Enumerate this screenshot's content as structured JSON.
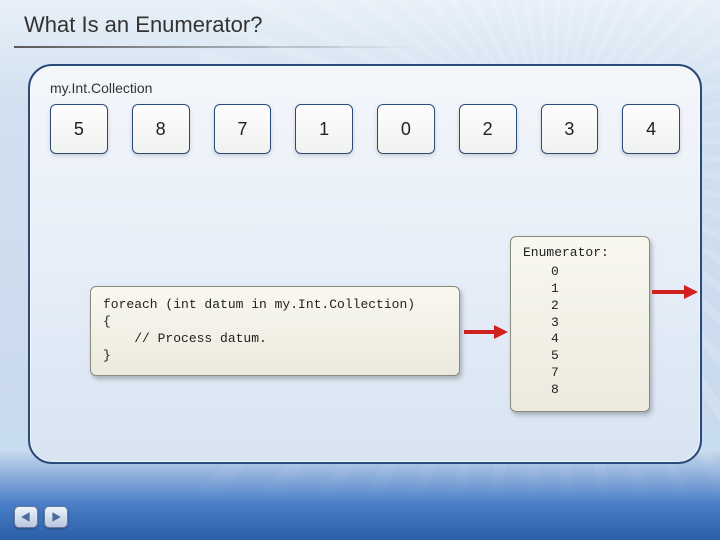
{
  "title": "What Is an Enumerator?",
  "collection": {
    "label": "my.Int.Collection",
    "items": [
      "5",
      "8",
      "7",
      "1",
      "0",
      "2",
      "3",
      "4"
    ]
  },
  "code": "foreach (int datum in my.Int.Collection)\n{\n    // Process datum.\n}",
  "enumerator": {
    "header": "Enumerator:",
    "values": [
      "0",
      "1",
      "2",
      "3",
      "4",
      "5",
      "7",
      "8"
    ]
  },
  "nav": {
    "prev_icon": "triangle-left-icon",
    "next_icon": "triangle-right-icon"
  },
  "colors": {
    "accent_border": "#2a4a7a",
    "arrow": "#d02020"
  }
}
